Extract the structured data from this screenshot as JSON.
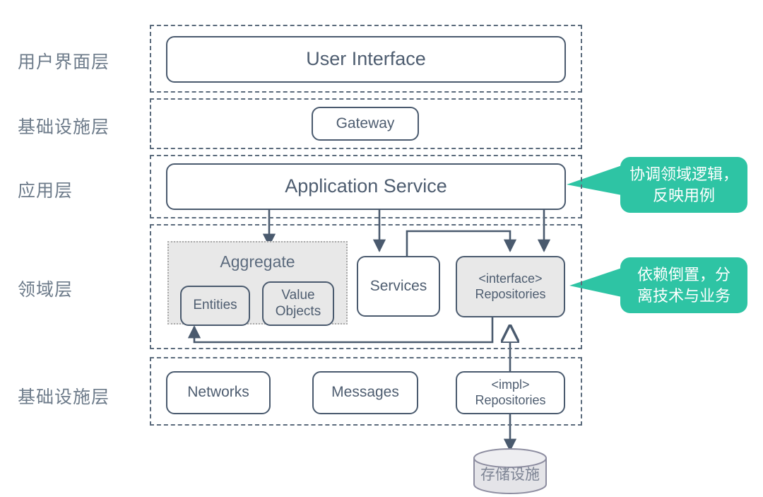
{
  "diagram": {
    "title": "DDD Layered Architecture",
    "colors": {
      "stroke": "#4a5a6e",
      "dashed_layer": "#5b6b7c",
      "text": "#4e5d70",
      "label_text": "#6d7b8a",
      "callout_green": "#2ec4a4",
      "fill_gray": "#e8e8e8",
      "cylinder_stroke": "#8d8da0",
      "cylinder_fill": "#e4e4e8"
    }
  },
  "layers": [
    {
      "label": "用户界面层"
    },
    {
      "label": "基础设施层"
    },
    {
      "label": "应用层"
    },
    {
      "label": "领域层"
    },
    {
      "label": "基础设施层"
    }
  ],
  "nodes": {
    "user_interface": "User Interface",
    "gateway": "Gateway",
    "application_service": "Application Service",
    "aggregate": "Aggregate",
    "entities": "Entities",
    "value_objects_line1": "Value",
    "value_objects_line2": "Objects",
    "services": "Services",
    "interface_repositories_line1": "<interface>",
    "interface_repositories_line2": "Repositories",
    "networks": "Networks",
    "messages": "Messages",
    "impl_repositories_line1": "<impl>",
    "impl_repositories_line2": "Repositories",
    "storage": "存储设施"
  },
  "callouts": [
    {
      "line1": "协调领域逻辑，",
      "line2": "反映用例"
    },
    {
      "line1": "依赖倒置，分",
      "line2": "离技术与业务"
    }
  ]
}
